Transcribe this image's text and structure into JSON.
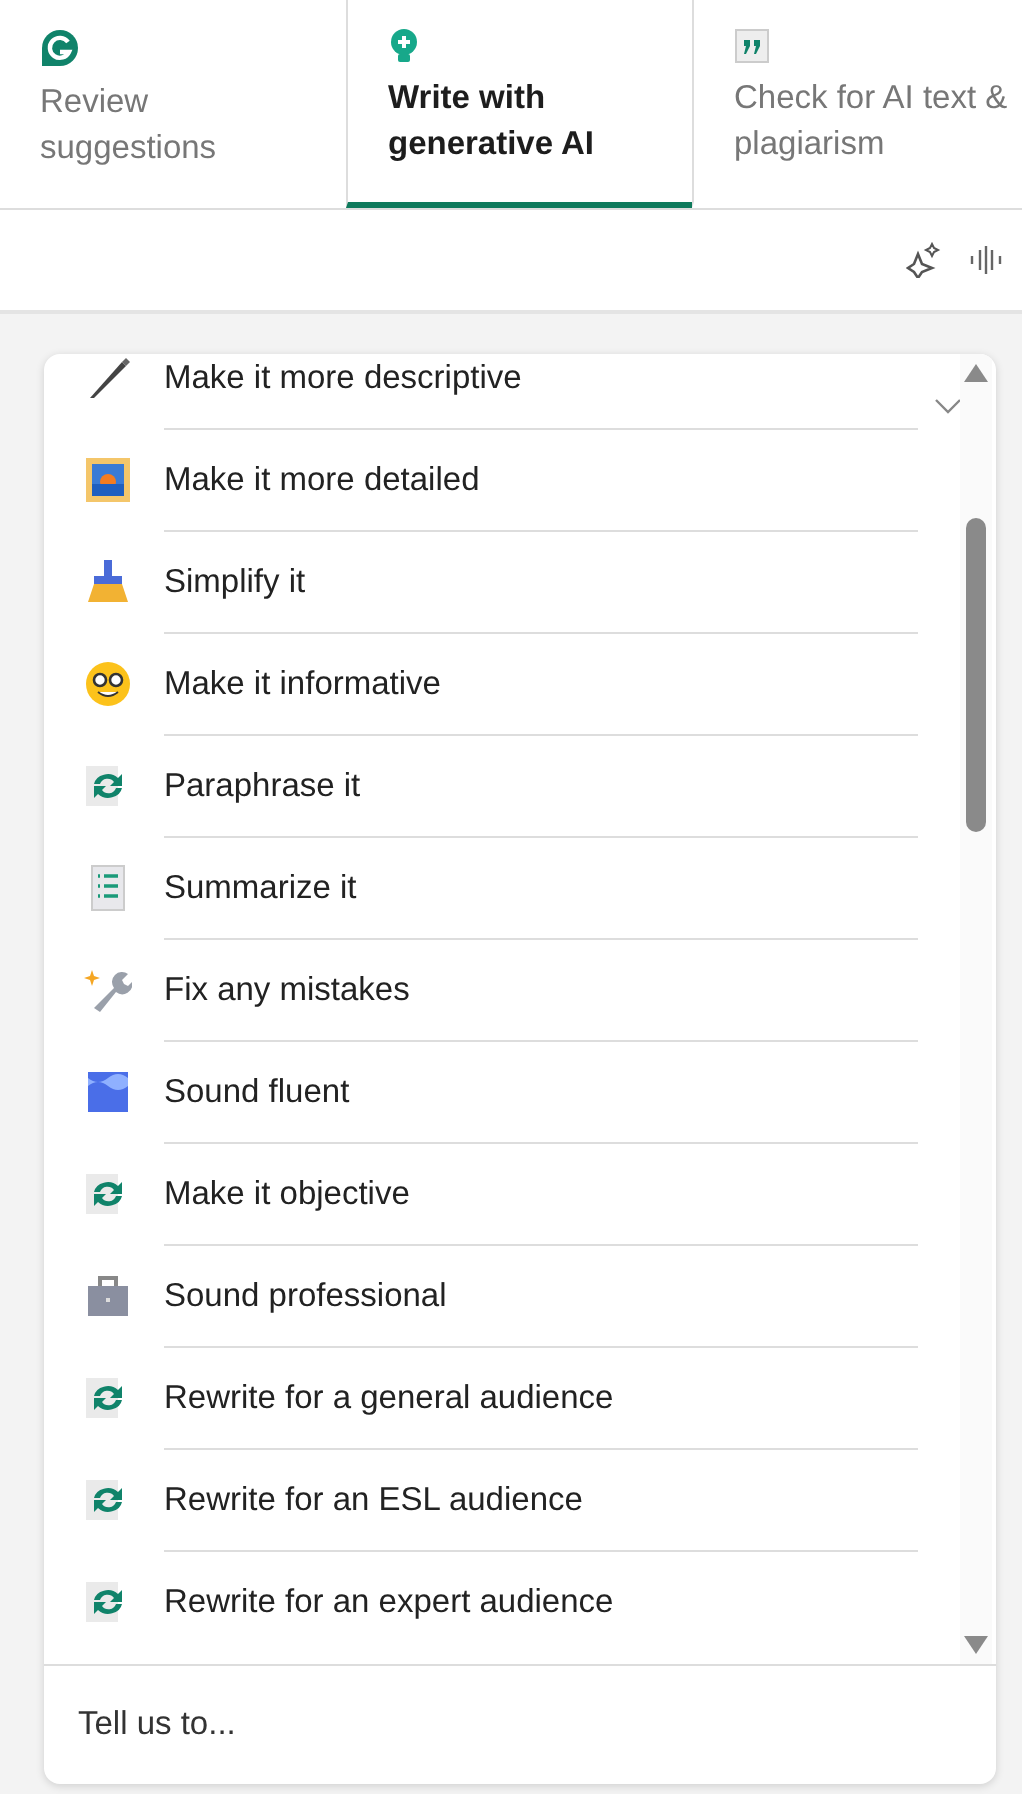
{
  "tabs": [
    {
      "kind": "grammarly",
      "label": "Review suggestions",
      "selected": false
    },
    {
      "kind": "bulb",
      "label": "Write with generative AI",
      "selected": true
    },
    {
      "kind": "quote",
      "label": "Check for AI text & plagiarism",
      "selected": false
    }
  ],
  "prompts": [
    {
      "kind": "pen",
      "label": "Make it more descriptive"
    },
    {
      "kind": "picture",
      "label": "Make it more detailed"
    },
    {
      "kind": "broom",
      "label": "Simplify it"
    },
    {
      "kind": "nerd",
      "label": "Make it informative"
    },
    {
      "kind": "cycle",
      "label": "Paraphrase it"
    },
    {
      "kind": "list",
      "label": "Summarize it"
    },
    {
      "kind": "wrench",
      "label": "Fix any mistakes"
    },
    {
      "kind": "wave",
      "label": "Sound fluent"
    },
    {
      "kind": "cycle",
      "label": "Make it objective"
    },
    {
      "kind": "briefcase",
      "label": "Sound professional"
    },
    {
      "kind": "cycle",
      "label": "Rewrite for a general audience"
    },
    {
      "kind": "cycle",
      "label": "Rewrite for an ESL audience"
    },
    {
      "kind": "cycle",
      "label": "Rewrite for an expert audience"
    }
  ],
  "prompt_input": {
    "placeholder": "Tell us to..."
  }
}
